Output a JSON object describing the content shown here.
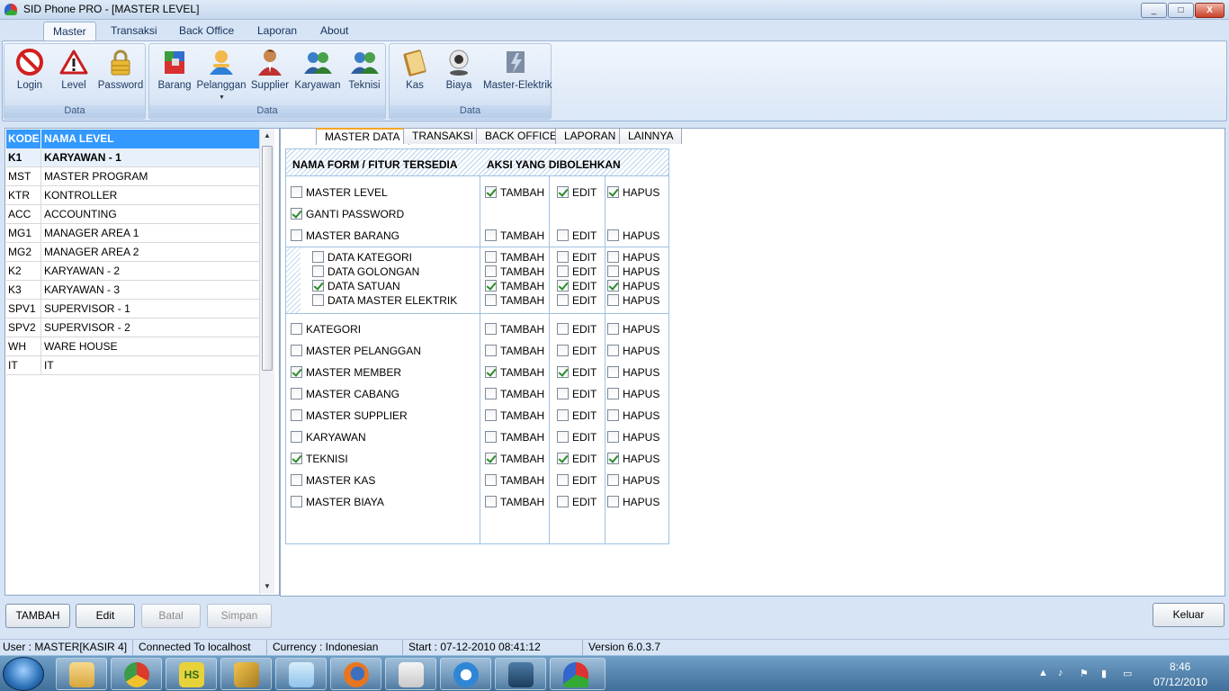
{
  "window": {
    "title": "SID Phone PRO - [MASTER LEVEL]",
    "controls": {
      "minimize": "_",
      "maximize": "□",
      "close": "X"
    }
  },
  "menu_tabs": [
    {
      "label": "Master",
      "active": true
    },
    {
      "label": "Transaksi"
    },
    {
      "label": "Back Office"
    },
    {
      "label": "Laporan"
    },
    {
      "label": "About"
    }
  ],
  "ribbon": {
    "groups": [
      {
        "label": "Data",
        "buttons": [
          {
            "label": "Login",
            "icon": "no-entry-icon"
          },
          {
            "label": "Level",
            "icon": "warning-icon"
          },
          {
            "label": "Password",
            "icon": "padlock-icon"
          }
        ]
      },
      {
        "label": "Data",
        "buttons": [
          {
            "label": "Barang",
            "icon": "boxes-icon"
          },
          {
            "label": "Pelanggan",
            "icon": "customer-icon"
          },
          {
            "label": "Supplier",
            "icon": "businessman-icon"
          },
          {
            "label": "Karyawan",
            "icon": "employees-icon"
          },
          {
            "label": "Teknisi",
            "icon": "technicians-icon"
          }
        ]
      },
      {
        "label": "Data",
        "buttons": [
          {
            "label": "Kas",
            "icon": "cash-book-icon"
          },
          {
            "label": "Biaya",
            "icon": "webcam-icon"
          },
          {
            "label": "Master-Elektrik",
            "icon": "electric-icon"
          }
        ]
      }
    ]
  },
  "level_grid": {
    "headers": {
      "kode": "KODE",
      "nama": "NAMA LEVEL"
    },
    "rows": [
      {
        "kode": "K1",
        "nama": "KARYAWAN - 1",
        "selected": true
      },
      {
        "kode": "MST",
        "nama": "MASTER PROGRAM"
      },
      {
        "kode": "KTR",
        "nama": "KONTROLLER"
      },
      {
        "kode": "ACC",
        "nama": "ACCOUNTING"
      },
      {
        "kode": "MG1",
        "nama": "MANAGER AREA 1"
      },
      {
        "kode": "MG2",
        "nama": "MANAGER AREA 2"
      },
      {
        "kode": "K2",
        "nama": "KARYAWAN - 2"
      },
      {
        "kode": "K3",
        "nama": "KARYAWAN - 3"
      },
      {
        "kode": "SPV1",
        "nama": "SUPERVISOR - 1"
      },
      {
        "kode": "SPV2",
        "nama": "SUPERVISOR - 2"
      },
      {
        "kode": "WH",
        "nama": "WARE HOUSE"
      },
      {
        "kode": "IT",
        "nama": "IT"
      }
    ]
  },
  "panel_tabs": [
    {
      "label": "MASTER DATA",
      "active": true
    },
    {
      "label": "TRANSAKSI"
    },
    {
      "label": "BACK OFFICE"
    },
    {
      "label": "LAPORAN"
    },
    {
      "label": "LAINNYA"
    }
  ],
  "matrix": {
    "col_form": "NAMA FORM /  FITUR TERSEDIA",
    "col_aksi": "AKSI YANG DIBOLEHKAN",
    "action_labels": {
      "tambah": "TAMBAH",
      "edit": "EDIT",
      "hapus": "HAPUS"
    },
    "group1": [
      {
        "form": "MASTER LEVEL",
        "checked": false,
        "tambah": true,
        "edit": true,
        "hapus": true
      },
      {
        "form": "GANTI PASSWORD",
        "checked": true
      },
      {
        "form": "MASTER BARANG",
        "checked": false,
        "tambah": false,
        "edit": false,
        "hapus": false
      }
    ],
    "group2": [
      {
        "form": "DATA KATEGORI",
        "checked": false,
        "tambah": false,
        "edit": false,
        "hapus": false
      },
      {
        "form": "DATA GOLONGAN",
        "checked": false,
        "tambah": false,
        "edit": false,
        "hapus": false
      },
      {
        "form": "DATA SATUAN",
        "checked": true,
        "tambah": true,
        "edit": true,
        "hapus": true
      },
      {
        "form": "DATA MASTER ELEKTRIK",
        "checked": false,
        "tambah": false,
        "edit": false,
        "hapus": false
      }
    ],
    "group3": [
      {
        "form": "KATEGORI",
        "checked": false,
        "tambah": false,
        "edit": false,
        "hapus": false
      },
      {
        "form": "MASTER PELANGGAN",
        "checked": false,
        "tambah": false,
        "edit": false,
        "hapus": false
      },
      {
        "form": "MASTER MEMBER",
        "checked": true,
        "tambah": true,
        "edit": true,
        "hapus": false
      },
      {
        "form": "MASTER CABANG",
        "checked": false,
        "tambah": false,
        "edit": false,
        "hapus": false
      },
      {
        "form": "MASTER SUPPLIER",
        "checked": false,
        "tambah": false,
        "edit": false,
        "hapus": false
      },
      {
        "form": "KARYAWAN",
        "checked": false,
        "tambah": false,
        "edit": false,
        "hapus": false
      },
      {
        "form": "TEKNISI",
        "checked": true,
        "tambah": true,
        "edit": true,
        "hapus": true
      },
      {
        "form": "MASTER KAS",
        "checked": false,
        "tambah": false,
        "edit": false,
        "hapus": false
      },
      {
        "form": "MASTER BIAYA",
        "checked": false,
        "tambah": false,
        "edit": false,
        "hapus": false
      }
    ]
  },
  "actions": {
    "tambah": "TAMBAH",
    "edit": "Edit",
    "batal": "Batal",
    "simpan": "Simpan",
    "keluar": "Keluar"
  },
  "status": {
    "user": "User : MASTER[KASIR 4]",
    "connection": "Connected To localhost",
    "currency": "Currency : Indonesian",
    "start": "Start  : 07-12-2010 08:41:12",
    "version": "Version 6.0.3.7"
  },
  "taskbar": {
    "items": [
      "explorer-icon",
      "chrome-icon",
      "hs-app-icon",
      "seven-zip-icon",
      "notepad-icon",
      "firefox-icon",
      "mail-icon",
      "ie-icon",
      "media-icon",
      "sid-phone-icon"
    ],
    "hs_label": "HS",
    "clock_time": "8:46",
    "clock_date": "07/12/2010"
  }
}
